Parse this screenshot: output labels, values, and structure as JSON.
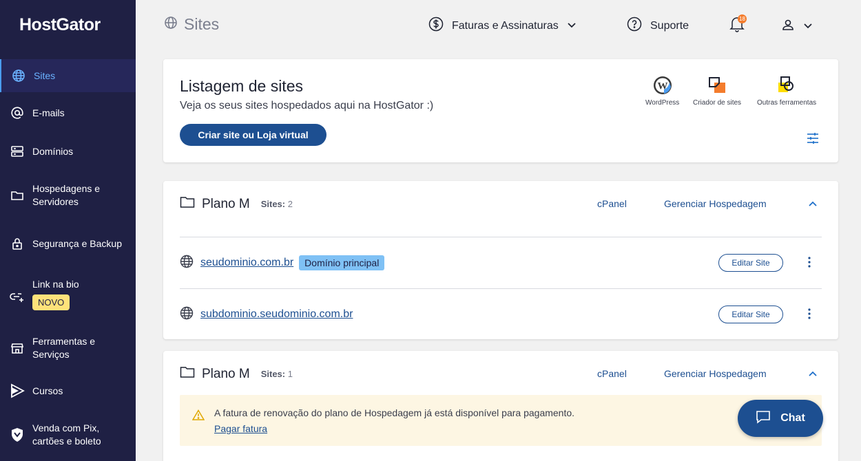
{
  "brand": {
    "logo": "HostGator"
  },
  "sidebar": {
    "items": [
      {
        "label": "Sites",
        "icon": "globe-icon",
        "active": true
      },
      {
        "label": "E-mails",
        "icon": "at-icon"
      },
      {
        "label": "Domínios",
        "icon": "server-icon"
      },
      {
        "label": "Hospedagens e Servidores",
        "icon": "folder-icon"
      },
      {
        "label": "Segurança e Backup",
        "icon": "lock-icon"
      },
      {
        "label": "Link na bio",
        "icon": "link-icon",
        "badge": "NOVO"
      },
      {
        "label": "Ferramentas e Serviços",
        "icon": "store-icon"
      },
      {
        "label": "Cursos",
        "icon": "play-icon"
      },
      {
        "label": "Venda com Pix, cartões e boleto",
        "icon": "shield-icon"
      }
    ]
  },
  "header": {
    "title": "Sites",
    "billing": "Faturas e Assinaturas",
    "support": "Suporte",
    "notifications": "18"
  },
  "listing": {
    "title": "Listagem de sites",
    "subtitle": "Veja os seus sites hospedados aqui na HostGator :)",
    "create_button": "Criar site ou Loja virtual",
    "tools": [
      {
        "label": "WordPress",
        "icon": "wordpress-icon"
      },
      {
        "label": "Criador de sites",
        "icon": "site-builder-icon"
      },
      {
        "label": "Outras ferramentas",
        "icon": "tools-icon"
      }
    ]
  },
  "plans": [
    {
      "name": "Plano M",
      "sites_label": "Sites:",
      "sites_count": "2",
      "cpanel": "cPanel",
      "manage": "Gerenciar Hospedagem",
      "sites": [
        {
          "domain": "seudominio.com.br",
          "tag": "Domínio principal",
          "edit": "Editar Site"
        },
        {
          "domain": "subdominio.seudominio.com.br",
          "edit": "Editar Site"
        }
      ]
    },
    {
      "name": "Plano M",
      "sites_label": "Sites:",
      "sites_count": "1",
      "cpanel": "cPanel",
      "manage": "Gerenciar Hospedagem",
      "alert": {
        "text": "A fatura de renovação do plano de Hospedagem já está disponível para pagamento.",
        "link": "Pagar fatura"
      }
    }
  ],
  "chat": {
    "label": "Chat"
  },
  "colors": {
    "sidebar": "#1f2044",
    "primary": "#1d4f91",
    "tag": "#7fc1f5",
    "badge": "#ffe27a"
  }
}
